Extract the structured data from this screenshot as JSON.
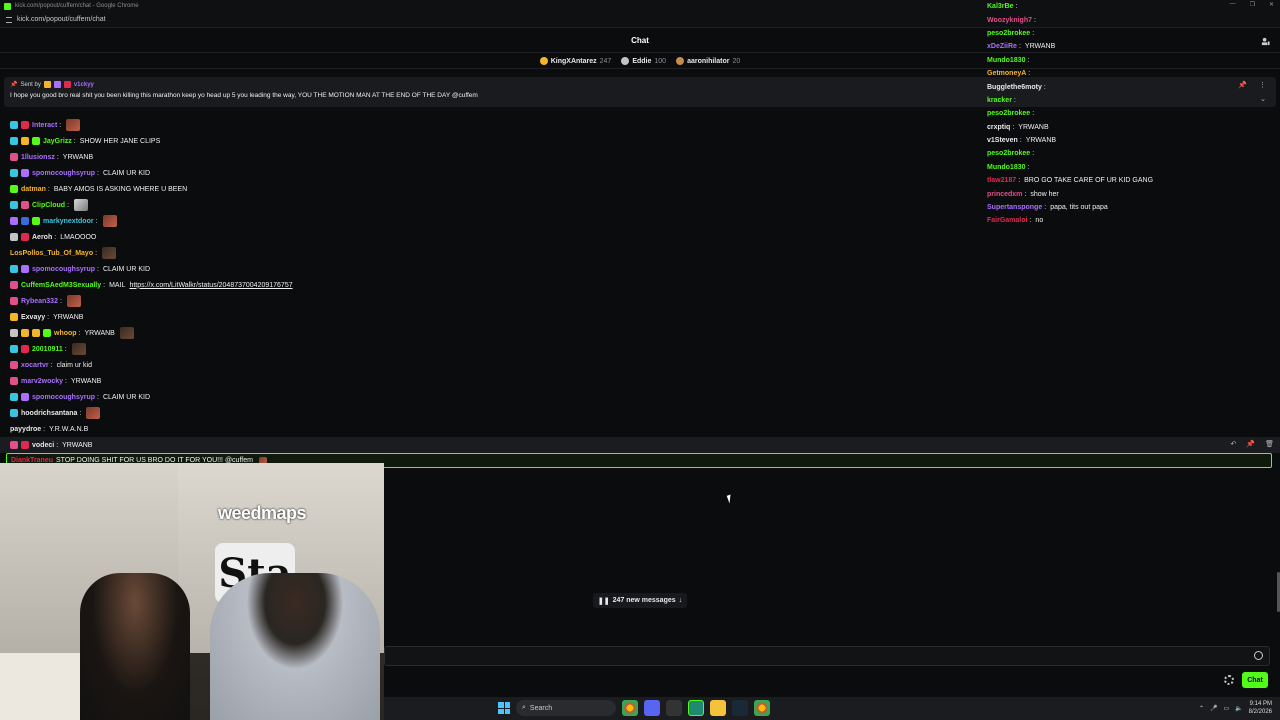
{
  "browser": {
    "window_title": "kick.com/popout/cuffem/chat - Google Chrome",
    "url": "kick.com/popout/cuffem/chat"
  },
  "header": {
    "title": "Chat"
  },
  "leaderboard": [
    {
      "name": "KingXAntarez",
      "count": "247",
      "color": "#f5b52b"
    },
    {
      "name": "Eddie",
      "count": "100",
      "color": "#c4c4c4"
    },
    {
      "name": "aaronihilator",
      "count": "20",
      "color": "#c98b4a"
    }
  ],
  "pinned": {
    "sent_by_label": "Sent by",
    "user": "v1ckyy",
    "message": "I hope you good bro real shit you been killing this marathon keep yo head up 5 you leading the way, YOU THE MOTION MAN AT THE END OF THE DAY @cuffem"
  },
  "messages": [
    {
      "user": "Interact",
      "color": "#a970ff",
      "text": "",
      "badges": [
        "#3ac5e0",
        "#e0294f"
      ],
      "emote": "red"
    },
    {
      "user": "JayGrizz",
      "color": "#53fc18",
      "text": "SHOW HER JANE CLIPS",
      "badges": [
        "#3ac5e0",
        "#f5b52b",
        "#53fc18"
      ]
    },
    {
      "user": "1llusionsz",
      "color": "#a970ff",
      "text": "YRWANB",
      "badges": [
        "#e0508a"
      ]
    },
    {
      "user": "spomocoughsyrup",
      "color": "#a970ff",
      "text": "CLAIM UR KID",
      "badges": [
        "#3ac5e0",
        "#a970ff"
      ]
    },
    {
      "user": "datman",
      "color": "#f5b52b",
      "text": "BABY AMOS IS ASKING WHERE U BEEN",
      "badges": [
        "#53fc18"
      ]
    },
    {
      "user": "ClipCloud",
      "color": "#53fc18",
      "text": "",
      "badges": [
        "#3ac5e0",
        "#e0508a"
      ],
      "emote": "light"
    },
    {
      "user": "markynextdoor",
      "color": "#3ac5e0",
      "text": "",
      "badges": [
        "#a970ff",
        "#3a6ae0",
        "#53fc18"
      ],
      "emote": "red"
    },
    {
      "user": "Aeroh",
      "color": "#e8e8e8",
      "text": "LMAOOOO",
      "badges": [
        "#c4c4c4",
        "#e0294f"
      ]
    },
    {
      "user": "LosPollos_Tub_Of_Mayo",
      "color": "#f5b52b",
      "text": "",
      "badges": [],
      "emote": "dark"
    },
    {
      "user": "spomocoughsyrup",
      "color": "#a970ff",
      "text": "CLAIM UR KID",
      "badges": [
        "#3ac5e0",
        "#a970ff"
      ]
    },
    {
      "user": "CuffemSAedM3Sexually",
      "color": "#53fc18",
      "text": "MAIL",
      "link": "https://x.com/LitWalkr/status/2048737004209176757",
      "badges": [
        "#e0508a"
      ]
    },
    {
      "user": "Rybean332",
      "color": "#a970ff",
      "text": "",
      "badges": [
        "#e0508a"
      ],
      "emote": "red"
    },
    {
      "user": "Exvayy",
      "color": "#e8e8e8",
      "text": "YRWANB",
      "badges": [
        "#f5b52b"
      ]
    },
    {
      "user": "whoop",
      "color": "#f5b52b",
      "text": "YRWANB",
      "badges": [
        "#c4c4c4",
        "#f5b52b",
        "#f5b52b",
        "#53fc18"
      ],
      "emote": "dark"
    },
    {
      "user": "20010911",
      "color": "#53fc18",
      "text": "",
      "badges": [
        "#3ac5e0",
        "#e0294f"
      ],
      "emote": "dark"
    },
    {
      "user": "xocartvr",
      "color": "#a970ff",
      "text": "claim ur kid",
      "badges": [
        "#e0508a"
      ]
    },
    {
      "user": "marv2wocky",
      "color": "#a970ff",
      "text": "YRWANB",
      "badges": [
        "#e0508a"
      ]
    },
    {
      "user": "spomocoughsyrup",
      "color": "#a970ff",
      "text": "CLAIM UR KID",
      "badges": [
        "#3ac5e0",
        "#a970ff"
      ]
    },
    {
      "user": "hoodrichsantana",
      "color": "#e8e8e8",
      "text": "",
      "badges": [
        "#3ac5e0"
      ],
      "emote": "red"
    },
    {
      "user": "payydroe",
      "color": "#e8e8e8",
      "text": "Y.R.W.A.N.B",
      "badges": []
    },
    {
      "user": "vodeci",
      "color": "#e8e8e8",
      "text": "YRWANB",
      "badges": [
        "#e0508a",
        "#e0294f"
      ]
    }
  ],
  "highlight": {
    "user": "DiankTraneu",
    "text": "STOP DOING SHIT FOR US BRO DO IT FOR YOU!!! @cuffem"
  },
  "right_messages": [
    {
      "user": "Kal3rBe",
      "color": "#53fc18",
      "text": ""
    },
    {
      "user": "Woozyknigh7",
      "color": "#e0508a",
      "text": ""
    },
    {
      "user": "peso2brokee",
      "color": "#53fc18",
      "text": ""
    },
    {
      "user": "xDeZiiRe",
      "color": "#a970ff",
      "text": "YRWANB"
    },
    {
      "user": "Mundo1830",
      "color": "#53fc18",
      "text": ""
    },
    {
      "user": "GetmoneyA",
      "color": "#f5b52b",
      "text": ""
    },
    {
      "user": "Bugglethe6moty",
      "color": "#e8e8e8",
      "text": ""
    },
    {
      "user": "kracker",
      "color": "#53fc18",
      "text": ""
    },
    {
      "user": "peso2brokee",
      "color": "#53fc18",
      "text": ""
    },
    {
      "user": "crxptiq",
      "color": "#e8e8e8",
      "text": "YRWANB"
    },
    {
      "user": "v1Steven",
      "color": "#e8e8e8",
      "text": "YRWANB"
    },
    {
      "user": "peso2brokee",
      "color": "#53fc18",
      "text": ""
    },
    {
      "user": "Mundo1830",
      "color": "#53fc18",
      "text": ""
    },
    {
      "user": "tlaw2187",
      "color": "#e0294f",
      "text": "BRO GO TAKE CARE OF UR KID GANG"
    },
    {
      "user": "princedxm",
      "color": "#e0508a",
      "text": "show her"
    },
    {
      "user": "Supertansponge",
      "color": "#a970ff",
      "text": "papa, tits out papa"
    },
    {
      "user": "FairGamaloi",
      "color": "#e0294f",
      "text": "no"
    }
  ],
  "webcam": {
    "banner_text": "weedmaps",
    "sign_text": "Sta"
  },
  "new_messages": {
    "label": "247 new messages"
  },
  "input": {
    "placeholder": ""
  },
  "footer": {
    "send_label": "Chat"
  },
  "taskbar": {
    "search_label": "Search",
    "time": "9:14 PM",
    "date": "8/2/2026"
  }
}
